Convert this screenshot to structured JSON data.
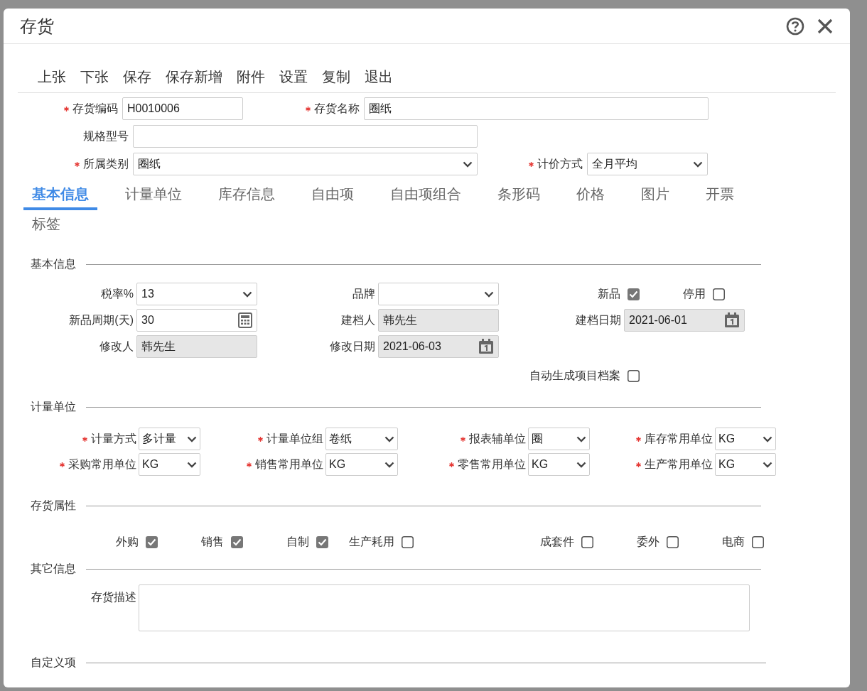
{
  "window": {
    "title": "存货"
  },
  "toolbar": [
    "上张",
    "下张",
    "保存",
    "保存新增",
    "附件",
    "设置",
    "复制",
    "退出"
  ],
  "header_rows": [
    [
      {
        "label": "存货编码",
        "required": true,
        "kind": "text",
        "value": "H0010006"
      },
      {
        "label": "存货名称",
        "required": true,
        "kind": "text",
        "value": "圈纸"
      }
    ],
    [
      {
        "label": "规格型号",
        "required": false,
        "kind": "text"
      }
    ],
    [
      {
        "label": "所属类别",
        "required": true,
        "kind": "select",
        "value": "圈纸"
      },
      {
        "label": "计价方式",
        "required": true,
        "kind": "select",
        "value": "全月平均"
      }
    ]
  ],
  "tabs": [
    {
      "label": "基本信息",
      "selected": true
    },
    {
      "label": "计量单位",
      "selected": false
    },
    {
      "label": "库存信息",
      "selected": false
    },
    {
      "label": "自由项",
      "selected": false
    },
    {
      "label": "自由项组合",
      "selected": false
    },
    {
      "label": "条形码",
      "selected": false
    },
    {
      "label": "价格",
      "selected": false
    },
    {
      "label": "图片",
      "selected": false
    },
    {
      "label": "开票",
      "selected": false
    },
    {
      "label": "标签",
      "selected": false
    }
  ],
  "basic_info": {
    "title": "基本信息",
    "rows": [
      [
        {
          "label": "税率%",
          "kind": "select",
          "value": "13",
          "disabled": false
        },
        {
          "label": "品牌",
          "kind": "select",
          "disabled": false
        },
        {
          "kind": "checks",
          "items": [
            {
              "label": "新品",
              "checked": true
            },
            {
              "label": "停用",
              "checked": false
            }
          ]
        }
      ],
      [
        {
          "label": "新品周期(天)",
          "kind": "calc",
          "value": "30",
          "disabled": false
        },
        {
          "label": "建档人",
          "kind": "text",
          "value": "韩先生",
          "disabled": true
        },
        {
          "label": "建档日期",
          "kind": "date",
          "value": "2021-06-01",
          "disabled": true
        }
      ],
      [
        {
          "label": "修改人",
          "kind": "text",
          "value": "韩先生",
          "disabled": true
        },
        {
          "label": "修改日期",
          "kind": "date",
          "value": "2021-06-03",
          "disabled": true
        },
        null
      ],
      [
        null,
        null,
        {
          "kind": "checks",
          "items": [
            {
              "label": "自动生成项目档案",
              "checked": false
            }
          ]
        }
      ]
    ]
  },
  "units": {
    "title": "计量单位",
    "rows": [
      [
        {
          "label": "计量方式",
          "required": true,
          "value": "多计量"
        },
        {
          "label": "计量单位组",
          "required": true,
          "value": "卷纸"
        },
        {
          "label": "报表辅单位",
          "required": true,
          "value": "圈"
        },
        {
          "label": "库存常用单位",
          "required": true,
          "value": "KG"
        }
      ],
      [
        {
          "label": "采购常用单位",
          "required": true,
          "value": "KG"
        },
        {
          "label": "销售常用单位",
          "required": true,
          "value": "KG"
        },
        {
          "label": "零售常用单位",
          "required": true,
          "value": "KG"
        },
        {
          "label": "生产常用单位",
          "required": true,
          "value": "KG"
        }
      ]
    ]
  },
  "attributes": {
    "title": "存货属性",
    "options": [
      {
        "label": "外购",
        "checked": true
      },
      {
        "label": "销售",
        "checked": true
      },
      {
        "label": "自制",
        "checked": true
      },
      {
        "label": "生产耗用",
        "checked": false
      },
      {
        "label": "成套件",
        "checked": false
      },
      {
        "label": "委外",
        "checked": false
      },
      {
        "label": "电商",
        "checked": false
      }
    ]
  },
  "other_info": {
    "title": "其它信息",
    "fields": [
      {
        "label": "存货描述",
        "kind": "textarea"
      }
    ]
  },
  "custom": {
    "title": "自定义项"
  }
}
